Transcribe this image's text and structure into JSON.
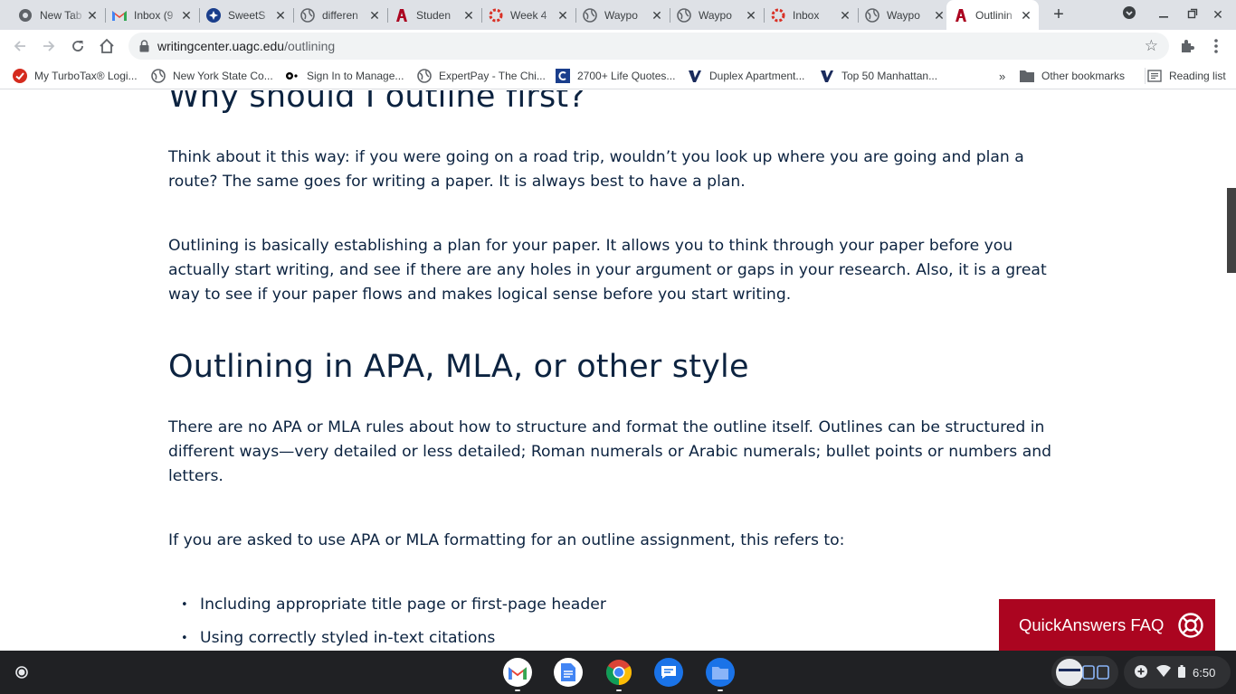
{
  "browser": {
    "tabs": [
      {
        "title": "New Tab",
        "favicon": "chrome-icon",
        "color": "#5f6368"
      },
      {
        "title": "Inbox (9",
        "favicon": "gmail-icon",
        "color": "#ea4335"
      },
      {
        "title": "SweetS",
        "favicon": "sweet-icon",
        "color": "#1a3e8c"
      },
      {
        "title": "differen",
        "favicon": "globe-icon",
        "color": "#5f6368"
      },
      {
        "title": "Studen",
        "favicon": "uagc-icon",
        "color": "#ab0520"
      },
      {
        "title": "Week 4",
        "favicon": "lifering-icon",
        "color": "#d93025"
      },
      {
        "title": "Waypo",
        "favicon": "globe-icon",
        "color": "#5f6368"
      },
      {
        "title": "Waypo",
        "favicon": "globe-icon",
        "color": "#5f6368"
      },
      {
        "title": "Inbox",
        "favicon": "lifering-icon",
        "color": "#d93025"
      },
      {
        "title": "Waypo",
        "favicon": "globe-icon",
        "color": "#5f6368"
      },
      {
        "title": "Outlinin",
        "favicon": "uagc-icon",
        "color": "#ab0520",
        "active": true
      }
    ],
    "url_host": "writingcenter.uagc.edu",
    "url_path": "/outlining",
    "bookmarks": [
      {
        "label": "My TurboTax® Logi...",
        "icon": "turbotax-icon",
        "color": "#d52b1e"
      },
      {
        "label": "New York State Co...",
        "icon": "globe-icon",
        "color": "#5f6368"
      },
      {
        "label": "Sign In to Manage...",
        "icon": "dots-icon",
        "color": "#000000"
      },
      {
        "label": "ExpertPay - The Chi...",
        "icon": "globe-icon",
        "color": "#5f6368"
      },
      {
        "label": "2700+ Life Quotes...",
        "icon": "quotes-c-icon",
        "color": "#1a3e8c"
      },
      {
        "label": "Duplex Apartment...",
        "icon": "v-logo-icon",
        "color": "#1a2b5c"
      },
      {
        "label": "Top 50 Manhattan...",
        "icon": "v-logo-icon",
        "color": "#1a2b5c"
      }
    ],
    "other_bookmarks": "Other bookmarks",
    "reading_list": "Reading list",
    "chevron": "»"
  },
  "page": {
    "heading1": "Why should I outline first?",
    "para1": "Think about it this way: if you were going on a road trip, wouldn’t you look up where you are going and plan a route? The same goes for writing a paper. It is always best to have a plan.",
    "para2": "Outlining is basically establishing a plan for your paper. It allows you to think through your paper before you actually start writing, and see if there are any holes in your argument or gaps in your research. Also, it is a great way to see if your paper flows and makes logical sense before you start writing.",
    "heading2": "Outlining in APA, MLA, or other style",
    "para3": "There are no APA or MLA rules about how to structure and format the outline itself. Outlines can be structured in different ways—very detailed or less detailed; Roman numerals or Arabic numerals; bullet points or numbers and letters.",
    "para4": "If you are asked to use APA or MLA formatting for an outline assignment, this refers to:",
    "bullets": [
      "Including appropriate title page or first-page header",
      "Using correctly styled in-text citations"
    ],
    "faq_label": "QuickAnswers FAQ"
  },
  "shelf": {
    "apps": [
      "gmail-icon",
      "docs-icon",
      "chrome-icon",
      "messages-icon",
      "files-icon"
    ],
    "time": "6:50"
  },
  "colors": {
    "heading": "#0c2340",
    "brand": "#ab0520",
    "tabstrip": "#dee1e6",
    "shelf": "#202124"
  }
}
